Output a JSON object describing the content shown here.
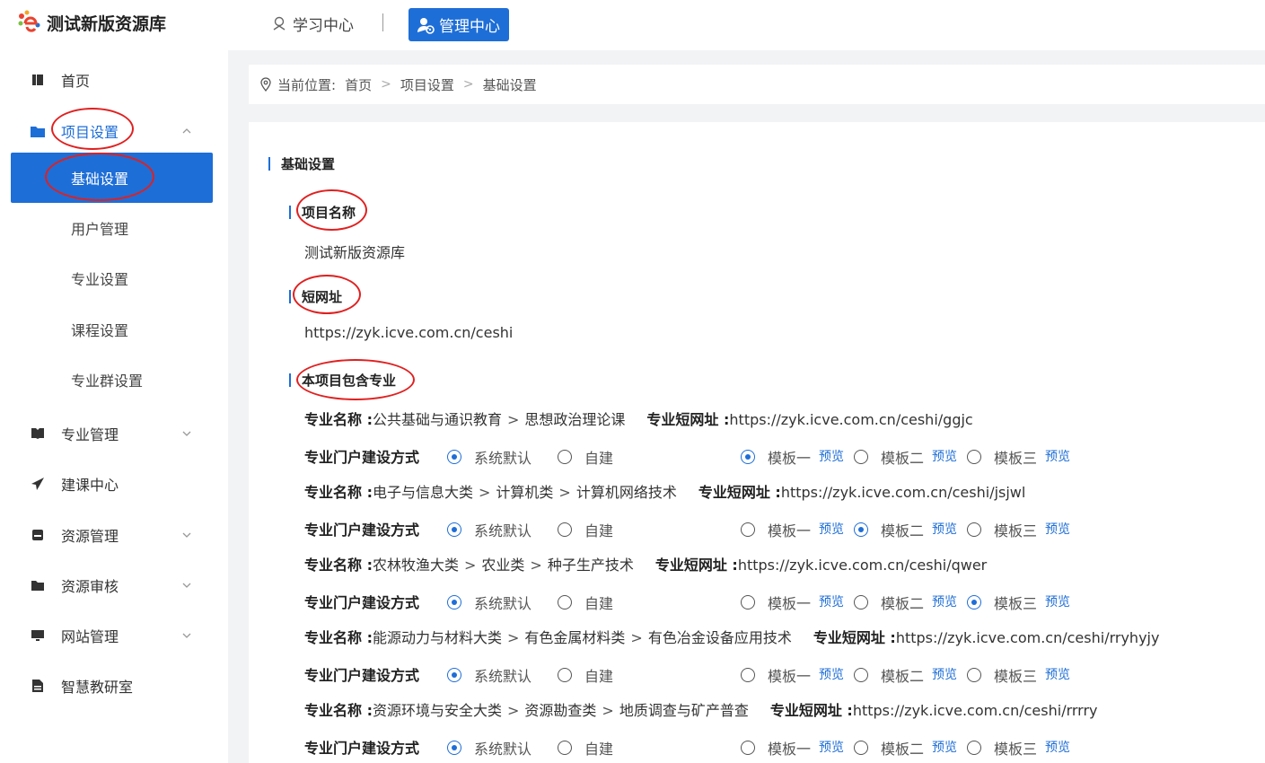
{
  "header": {
    "app_title": "测试新版资源库",
    "nav_learning": "学习中心",
    "nav_admin": "管理中心"
  },
  "sidebar": {
    "items": [
      {
        "label": "首页"
      },
      {
        "label": "项目设置"
      },
      {
        "label": "专业管理"
      },
      {
        "label": "建课中心"
      },
      {
        "label": "资源管理"
      },
      {
        "label": "资源审核"
      },
      {
        "label": "网站管理"
      },
      {
        "label": "智慧教研室"
      }
    ],
    "sub_items": [
      {
        "label": "基础设置"
      },
      {
        "label": "用户管理"
      },
      {
        "label": "专业设置"
      },
      {
        "label": "课程设置"
      },
      {
        "label": "专业群设置"
      }
    ]
  },
  "breadcrumb": {
    "prefix": "当前位置:",
    "items": [
      "首页",
      "项目设置",
      "基础设置"
    ]
  },
  "main": {
    "section_title": "基础设置",
    "project_name_label": "项目名称",
    "project_name_value": "测试新版资源库",
    "short_url_label": "短网址",
    "short_url_value": "https://zyk.icve.com.cn/ceshi",
    "majors_label": "本项目包含专业",
    "major_name_key": "专业名称 :",
    "major_url_key": "专业短网址 :",
    "build_key": "专业门户建设方式",
    "opt_default": "系统默认",
    "opt_custom": "自建",
    "tpl1": "模板一",
    "tpl2": "模板二",
    "tpl3": "模板三",
    "preview": "预览",
    "majors": [
      {
        "path": [
          "公共基础与通识教育",
          "思想政治理论课"
        ],
        "url": "https://zyk.icve.com.cn/ceshi/ggjc",
        "build": "default",
        "template": 1
      },
      {
        "path": [
          "电子与信息大类",
          "计算机类",
          "计算机网络技术"
        ],
        "url": "https://zyk.icve.com.cn/ceshi/jsjwl",
        "build": "default",
        "template": 2
      },
      {
        "path": [
          "农林牧渔大类",
          "农业类",
          "种子生产技术"
        ],
        "url": "https://zyk.icve.com.cn/ceshi/qwer",
        "build": "default",
        "template": 3
      },
      {
        "path": [
          "能源动力与材料大类",
          "有色金属材料类",
          "有色冶金设备应用技术"
        ],
        "url": "https://zyk.icve.com.cn/ceshi/rryhyjy",
        "build": "default",
        "template": 0
      },
      {
        "path": [
          "资源环境与安全大类",
          "资源勘查类",
          "地质调查与矿产普查"
        ],
        "url": "https://zyk.icve.com.cn/ceshi/rrrry",
        "build": "default",
        "template": 0
      }
    ]
  },
  "colors": {
    "accent": "#1e6ed7",
    "annotation": "#e02020"
  }
}
